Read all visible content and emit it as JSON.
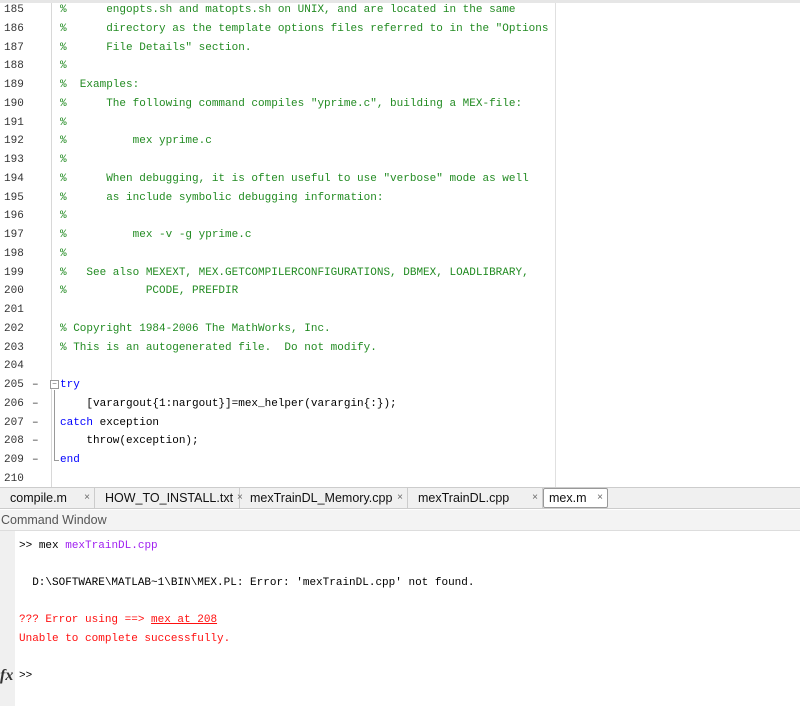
{
  "editor": {
    "lines": [
      {
        "n": "185",
        "t": "%      engopts.sh and matopts.sh on UNIX, and are located in the same",
        "type": "cm"
      },
      {
        "n": "186",
        "t": "%      directory as the template options files referred to in the \"Options",
        "type": "cm"
      },
      {
        "n": "187",
        "t": "%      File Details\" section.",
        "type": "cm"
      },
      {
        "n": "188",
        "t": "%",
        "type": "cm"
      },
      {
        "n": "189",
        "t": "%  Examples:",
        "type": "cm"
      },
      {
        "n": "190",
        "t": "%      The following command compiles \"yprime.c\", building a MEX-file:",
        "type": "cm"
      },
      {
        "n": "191",
        "t": "%",
        "type": "cm"
      },
      {
        "n": "192",
        "t": "%          mex yprime.c",
        "type": "cm"
      },
      {
        "n": "193",
        "t": "%",
        "type": "cm"
      },
      {
        "n": "194",
        "t": "%      When debugging, it is often useful to use \"verbose\" mode as well",
        "type": "cm"
      },
      {
        "n": "195",
        "t": "%      as include symbolic debugging information:",
        "type": "cm"
      },
      {
        "n": "196",
        "t": "%",
        "type": "cm"
      },
      {
        "n": "197",
        "t": "%          mex -v -g yprime.c",
        "type": "cm"
      },
      {
        "n": "198",
        "t": "%",
        "type": "cm"
      },
      {
        "n": "199",
        "t": "%   See also MEXEXT, MEX.GETCOMPILERCONFIGURATIONS, DBMEX, LOADLIBRARY,",
        "type": "cm"
      },
      {
        "n": "200",
        "t": "%            PCODE, PREFDIR",
        "type": "cm"
      },
      {
        "n": "201",
        "t": "",
        "type": "cm"
      },
      {
        "n": "202",
        "t": "% Copyright 1984-2006 The MathWorks, Inc.",
        "type": "cm"
      },
      {
        "n": "203",
        "t": "% This is an autogenerated file.  Do not modify.",
        "type": "cm"
      },
      {
        "n": "204",
        "t": "",
        "type": "cm"
      },
      {
        "n": "205",
        "t": "try",
        "type": "kw",
        "dash": "–"
      },
      {
        "n": "206",
        "t": "    [varargout{1:nargout}]=mex_helper(varargin{:});",
        "type": "code",
        "dash": "–"
      },
      {
        "n": "207",
        "t": "catch",
        "t2": " exception",
        "type": "kw2",
        "dash": "–"
      },
      {
        "n": "208",
        "t": "    throw(exception);",
        "type": "code",
        "dash": "–"
      },
      {
        "n": "209",
        "t": "end",
        "type": "kw",
        "dash": "–"
      },
      {
        "n": "210",
        "t": "",
        "type": "code"
      }
    ]
  },
  "tabs": [
    {
      "label": "compile.m",
      "close": "×"
    },
    {
      "label": "HOW_TO_INSTALL.txt",
      "close": "×"
    },
    {
      "label": "mexTrainDL_Memory.cpp",
      "close": "×"
    },
    {
      "label": "mexTrainDL.cpp",
      "close": "×"
    },
    {
      "label": "mex.m",
      "close": "×",
      "active": true
    }
  ],
  "command_window": {
    "title": "Command Window",
    "prompt": ">>",
    "cmd": "mex",
    "cmd_arg": "mexTrainDL.cpp",
    "output": "  D:\\SOFTWARE\\MATLAB~1\\BIN\\MEX.PL: Error: 'mexTrainDL.cpp' not found.",
    "error_prefix": "??? Error using ==> ",
    "error_link": "mex at 208",
    "error_msg": "Unable to complete successfully.",
    "fx_icon": "fx",
    "new_prompt": ">>"
  },
  "colors": {
    "comment": "#228b22",
    "keyword": "#0000ff",
    "error": "#ff1010",
    "string": "#a020f0"
  }
}
